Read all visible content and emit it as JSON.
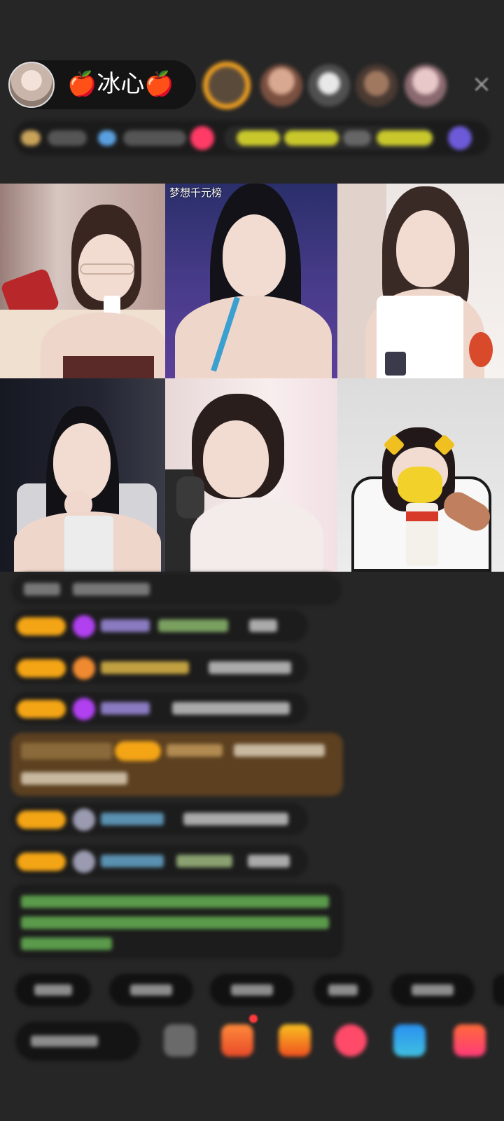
{
  "header": {
    "host_name": "🍎冰心🍎",
    "close_label": "×"
  },
  "video_grid": {
    "tiles": [
      {
        "label": ""
      },
      {
        "label": "梦想千元榜"
      },
      {
        "label": ""
      },
      {
        "label": ""
      },
      {
        "label": ""
      },
      {
        "label": ""
      }
    ]
  },
  "colors": {
    "background": "#262626",
    "badge": "#f4a515",
    "highlight_row": "#5c4020",
    "pill": "#141414"
  }
}
